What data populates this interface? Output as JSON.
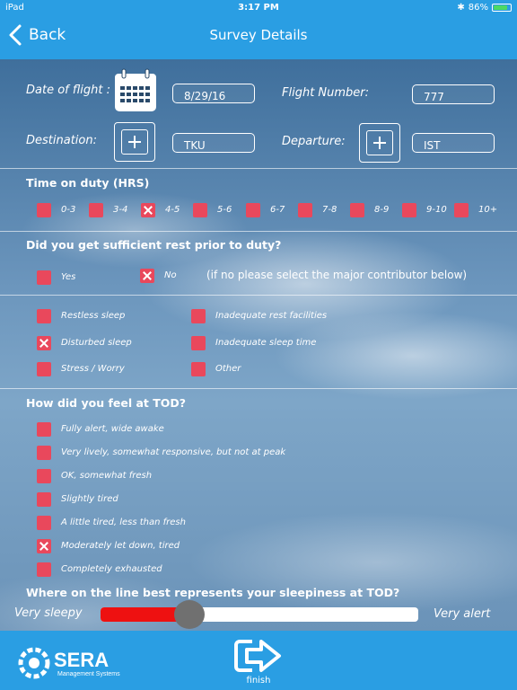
{
  "status_bar": {
    "device": "iPad",
    "time": "3:17 PM",
    "battery": "86%",
    "battery_level": 0.86
  },
  "nav": {
    "back_label": "Back",
    "title": "Survey Details"
  },
  "flight": {
    "date_label": "Date of flight :",
    "date_value": "8/29/16",
    "flight_number_label": "Flight Number:",
    "flight_number_value": "777",
    "destination_label": "Destination:",
    "destination_value": "TKU",
    "departure_label": "Departure:",
    "departure_value": "IST"
  },
  "time_on_duty": {
    "title": "Time on duty (HRS)",
    "options": [
      {
        "label": "0-3",
        "checked": false
      },
      {
        "label": "3-4",
        "checked": false
      },
      {
        "label": "4-5",
        "checked": true
      },
      {
        "label": "5-6",
        "checked": false
      },
      {
        "label": "6-7",
        "checked": false
      },
      {
        "label": "7-8",
        "checked": false
      },
      {
        "label": "8-9",
        "checked": false
      },
      {
        "label": "9-10",
        "checked": false
      },
      {
        "label": "10+",
        "checked": false
      }
    ]
  },
  "rest": {
    "title": "Did you get sufficient rest prior to duty?",
    "yes_label": "Yes",
    "yes_checked": false,
    "no_label": "No",
    "no_checked": true,
    "note": "(if no please select the major contributor below)"
  },
  "contributors": {
    "left": [
      {
        "label": "Restless sleep",
        "checked": false
      },
      {
        "label": "Disturbed sleep",
        "checked": true
      },
      {
        "label": "Stress / Worry",
        "checked": false
      }
    ],
    "right": [
      {
        "label": "Inadequate rest facilities",
        "checked": false
      },
      {
        "label": "Inadequate sleep time",
        "checked": false
      },
      {
        "label": "Other",
        "checked": false
      }
    ]
  },
  "feel": {
    "title": "How did you feel at TOD?",
    "options": [
      {
        "label": "Fully alert, wide awake",
        "checked": false
      },
      {
        "label": "Very lively, somewhat responsive, but not at peak",
        "checked": false
      },
      {
        "label": "OK, somewhat fresh",
        "checked": false
      },
      {
        "label": "Slightly tired",
        "checked": false
      },
      {
        "label": "A little tired, less than fresh",
        "checked": false
      },
      {
        "label": "Moderately let down, tired",
        "checked": true
      },
      {
        "label": "Completely exhausted",
        "checked": false
      }
    ]
  },
  "sleepiness": {
    "title": "Where on the line best represents your sleepiness at TOD?",
    "min_label": "Very sleepy",
    "max_label": "Very alert",
    "value": 0.28
  },
  "footer": {
    "logo_text": "SERA",
    "logo_subtext": "Management Systems",
    "finish_label": "finish"
  },
  "colors": {
    "bar": "#2a9ee3",
    "checkbox": "#e9485c",
    "slider_fill": "#ee1111"
  }
}
